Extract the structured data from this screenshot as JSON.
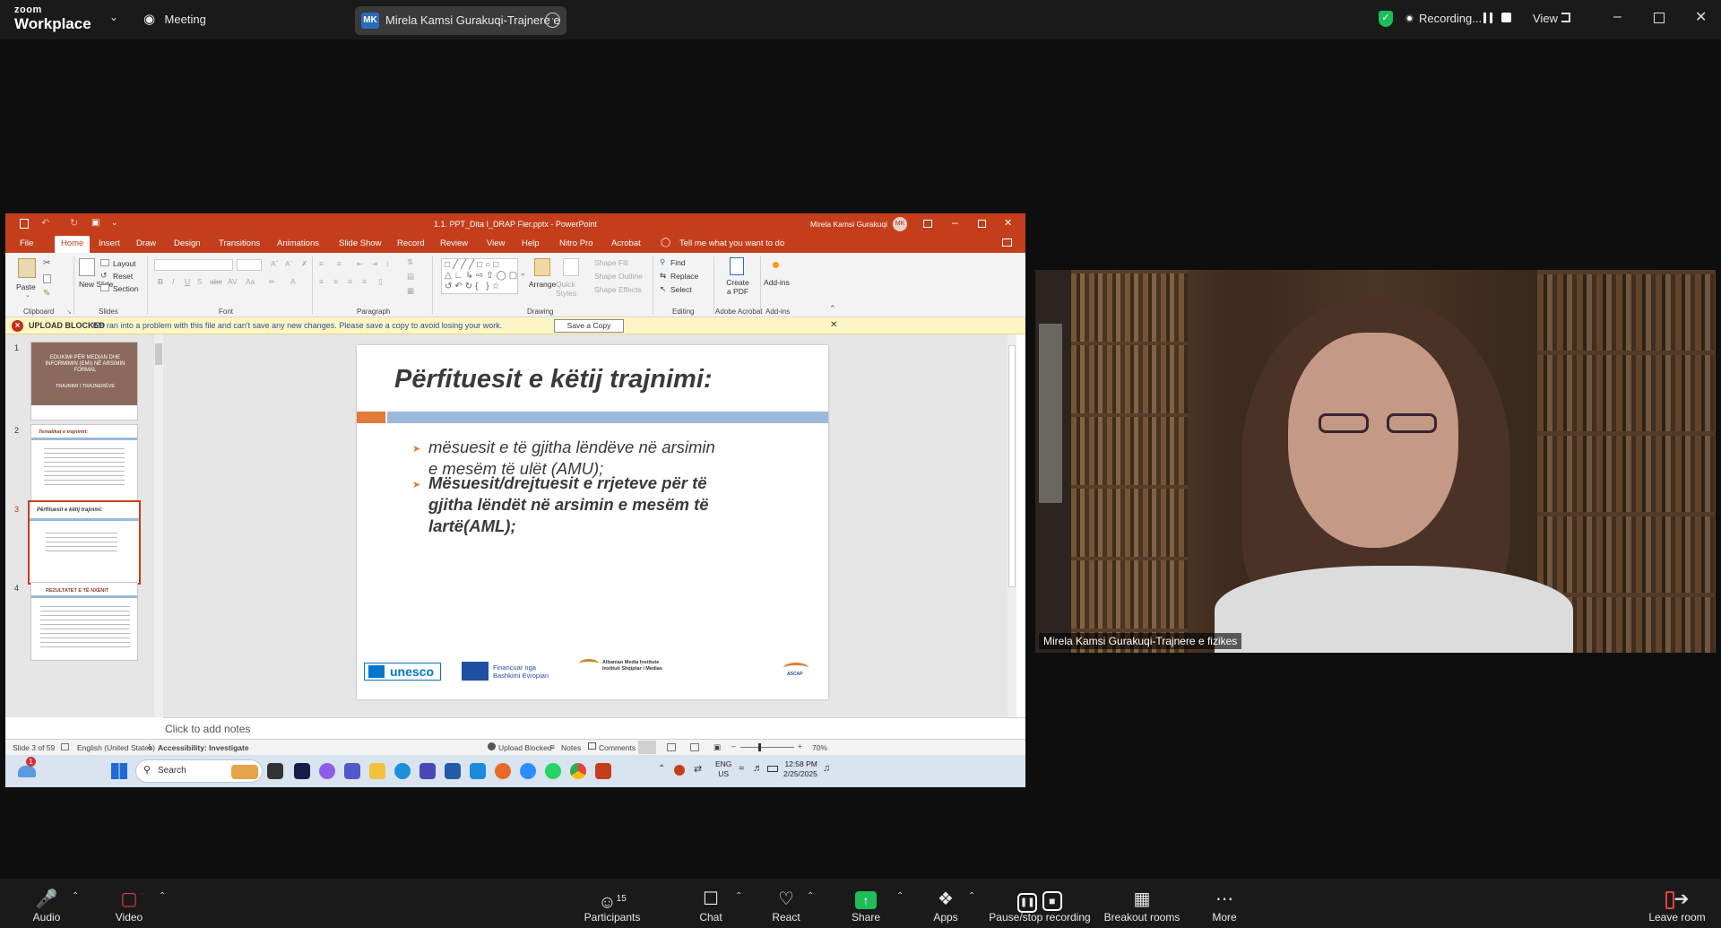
{
  "zoom": {
    "logo_top": "zoom",
    "logo_bottom": "Workplace",
    "meeting_label": "Meeting",
    "participant_pill": {
      "initials": "MK",
      "name": "Mirela Kamsi Gurakuqi-Trajnere e"
    },
    "recording_label": "Recording...",
    "view_label": "View"
  },
  "powerpoint": {
    "window_title": "1.1. PPT_Dita I_DRAP Fier.pptx  -  PowerPoint",
    "user_name": "Mirela Kamsi Gurakuqi",
    "user_initials": "MK",
    "tabs": [
      "File",
      "Home",
      "Insert",
      "Draw",
      "Design",
      "Transitions",
      "Animations",
      "Slide Show",
      "Record",
      "Review",
      "View",
      "Help",
      "Nitro Pro",
      "Acrobat"
    ],
    "tell_me": "Tell me what you want to do",
    "ribbon": {
      "paste": "Paste",
      "layout": "Layout",
      "reset": "Reset",
      "new_slide": "New Slide",
      "section": "Section",
      "clipboard": "Clipboard",
      "slides": "Slides",
      "font": "Font",
      "paragraph": "Paragraph",
      "drawing": "Drawing",
      "editing": "Editing",
      "adobe_acrobat": "Adobe Acrobat",
      "add_ins": "Add-ins",
      "arrange": "Arrange",
      "quick_styles": "Quick Styles",
      "shape_fill": "Shape Fill",
      "shape_outline": "Shape Outline",
      "shape_effects": "Shape Effects",
      "find": "Find",
      "replace": "Replace",
      "select": "Select",
      "create_pdf": "Create a PDF",
      "add_ins_btn": "Add-ins"
    },
    "upload_bar": {
      "label": "UPLOAD BLOCKED",
      "message": "We ran into a problem with this file and can't save any new changes. Please save a copy to avoid losing your work.",
      "button": "Save a Copy"
    },
    "thumbnails": [
      {
        "num": "1",
        "title": "EDUKIMI PËR MEDIAN DHE INFORMIMIN (EMI) NË ARSIMIN FORMAL",
        "sub": "TRAJNIMI I TRAJNERËVE"
      },
      {
        "num": "2",
        "title": "Tematikat e trajnimit:"
      },
      {
        "num": "3",
        "title": "Përfituesit e këtij trajnimi:"
      },
      {
        "num": "4",
        "title": "REZULTATET E TË NXËNIT"
      }
    ],
    "slide": {
      "title": "Përfituesit e këtij trajnimi:",
      "bullet1": "mësuesit e  të gjitha lëndëve në arsimin e mesëm të ulët (AMU);",
      "bullet2": "Mësuesit/drejtuesit e rrjeteve për  të gjitha lëndët në arsimin e mesëm të lartë(AML);",
      "logo_unesco": "unesco",
      "logo_eu_1": "Financuar nga",
      "logo_eu_2": "Bashkimi Evropian",
      "logo_ami_1": "Albanian Media Institute",
      "logo_ami_2": "Instituti Shqiptar i Medias",
      "logo_ascap": "ASCAP"
    },
    "notes_placeholder": "Click to add notes",
    "status": {
      "slide_info": "Slide 3 of 59",
      "language": "English (United States)",
      "accessibility": "Accessibility: Investigate",
      "upload_blocked": "Upload Blocked",
      "notes": "Notes",
      "comments": "Comments",
      "zoom": "70%"
    },
    "taskbar": {
      "search": "Search",
      "lang_1": "ENG",
      "lang_2": "US",
      "time": "12:58 PM",
      "date": "2/25/2025",
      "badge": "1"
    }
  },
  "video": {
    "name_tag": "Mirela Kamsi Gurakuqi-Trajnere e fizikes"
  },
  "toolbar": {
    "audio": "Audio",
    "video": "Video",
    "participants": "Participants",
    "participants_count": "15",
    "chat": "Chat",
    "react": "React",
    "share": "Share",
    "apps": "Apps",
    "pause_recording": "Pause/stop recording",
    "breakout": "Breakout rooms",
    "more": "More",
    "leave": "Leave room"
  },
  "colors": {
    "ppt_red": "#c43e1c",
    "share_green": "#1fbd5a",
    "slide_orange": "#e07b39",
    "slide_blue": "#9bb9d8"
  }
}
